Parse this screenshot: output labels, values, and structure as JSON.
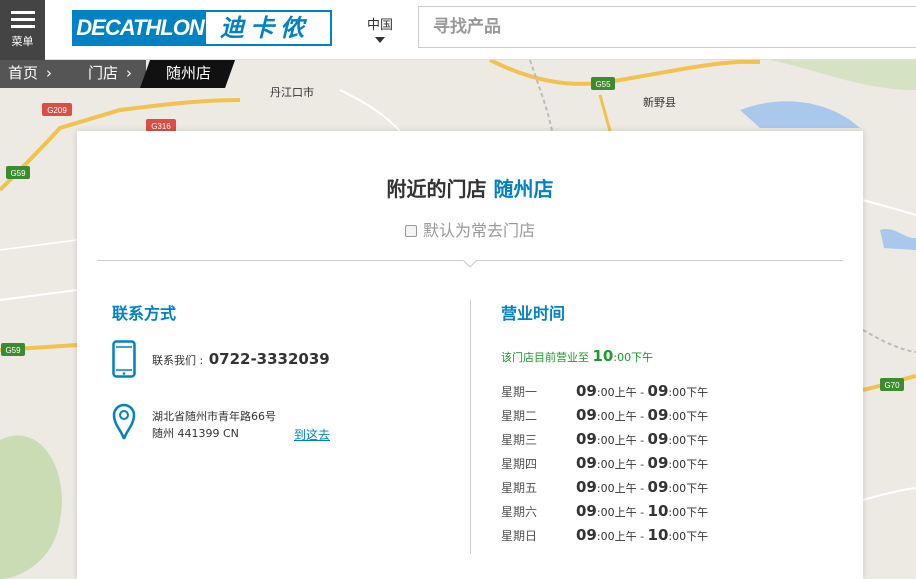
{
  "header": {
    "menu_label": "菜单",
    "logo_en": "DECATHLON",
    "logo_cn": "迪卡侬",
    "country": "中国",
    "search_placeholder": "寻找产品"
  },
  "breadcrumb": [
    "首页",
    "门店",
    "随州店"
  ],
  "map": {
    "labels": [
      "丹江口市",
      "新野县"
    ],
    "shields": [
      "G209",
      "G316",
      "G59",
      "G55",
      "G59",
      "G70"
    ]
  },
  "store": {
    "title_prefix": "附近的门店",
    "name": "随州店",
    "favorite_label": "默认为常去门店"
  },
  "contact": {
    "heading": "联系方式",
    "phone_label": "联系我们 :",
    "phone": "0722-3332039",
    "address_line1": "湖北省随州市青年路66号",
    "address_line2": "随州 441399 CN",
    "route_link": "到这去"
  },
  "hours": {
    "heading": "营业时间",
    "status_prefix": "该门店目前营业至",
    "status_time": "10",
    "status_suffix": ":00下午",
    "days": [
      {
        "day": "星期一",
        "open": "09",
        "open_suffix": ":00上午",
        "close": "09",
        "close_suffix": ":00下午"
      },
      {
        "day": "星期二",
        "open": "09",
        "open_suffix": ":00上午",
        "close": "09",
        "close_suffix": ":00下午"
      },
      {
        "day": "星期三",
        "open": "09",
        "open_suffix": ":00上午",
        "close": "09",
        "close_suffix": ":00下午"
      },
      {
        "day": "星期四",
        "open": "09",
        "open_suffix": ":00上午",
        "close": "09",
        "close_suffix": ":00下午"
      },
      {
        "day": "星期五",
        "open": "09",
        "open_suffix": ":00上午",
        "close": "09",
        "close_suffix": ":00下午"
      },
      {
        "day": "星期六",
        "open": "09",
        "open_suffix": ":00上午",
        "close": "10",
        "close_suffix": ":00下午"
      },
      {
        "day": "星期日",
        "open": "09",
        "open_suffix": ":00上午",
        "close": "10",
        "close_suffix": ":00下午"
      }
    ]
  },
  "colors": {
    "brand": "#0082c3",
    "open_status": "#1b9b2a",
    "map_bg": "#eceae3",
    "road_yellow": "#f2c14e",
    "shield_green": "#3d8b2f"
  }
}
